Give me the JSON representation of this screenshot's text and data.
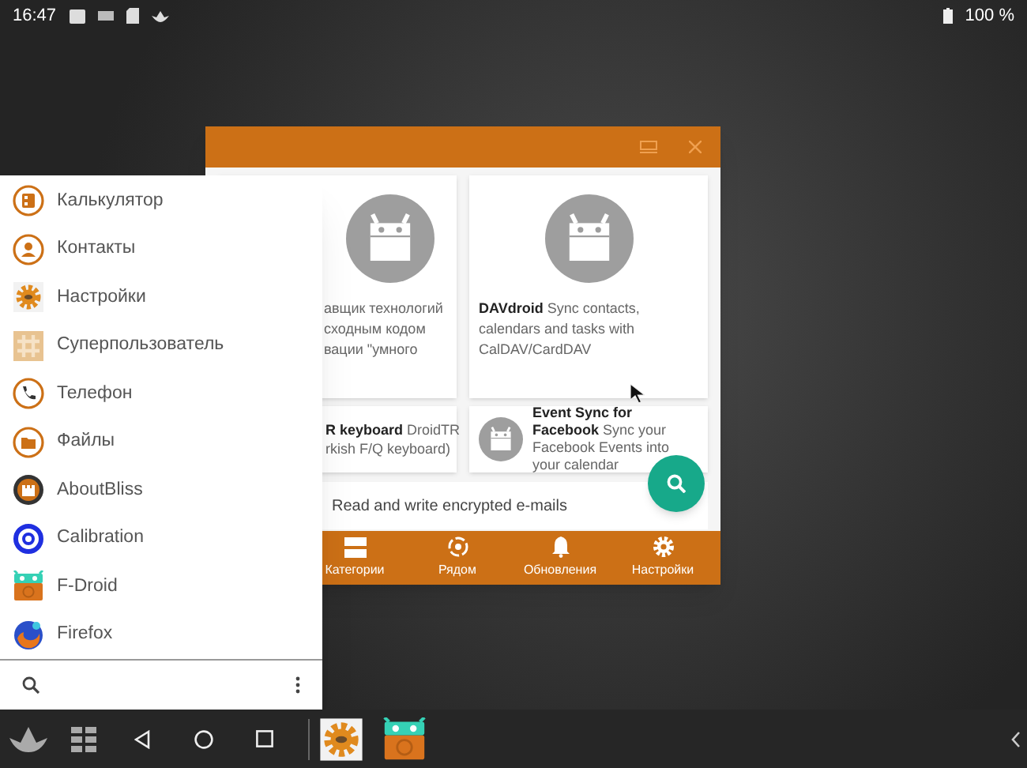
{
  "status_bar": {
    "time": "16:47",
    "battery": "100 %"
  },
  "window": {
    "cards": [
      {
        "kind": "large",
        "lines": [
          "авщик технологий",
          "сходным кодом",
          "вации \"умного"
        ]
      },
      {
        "kind": "large",
        "lines": [
          "**DAVdroid** Sync contacts, calendars and tasks with CalDAV/CardDAV"
        ]
      },
      {
        "kind": "small",
        "lines": [
          "**R keyboard** DroidTR",
          "rkish F/Q keyboard)"
        ]
      },
      {
        "kind": "small-icon",
        "lines": [
          "**Event Sync for Facebook** Sync your Facebook Events into your calendar"
        ]
      }
    ],
    "list_text": "Read and write encrypted e-mails",
    "nav": [
      {
        "kind": "categories",
        "label": "Категории"
      },
      {
        "kind": "nearby",
        "label": "Рядом"
      },
      {
        "kind": "updates",
        "label": "Обновления"
      },
      {
        "kind": "settings",
        "label": "Настройки"
      }
    ]
  },
  "start_menu": {
    "items": [
      {
        "kind": "calculator",
        "label": "Калькулятор"
      },
      {
        "kind": "contacts",
        "label": "Контакты"
      },
      {
        "kind": "settings",
        "label": "Настройки"
      },
      {
        "kind": "superuser",
        "label": "Суперпользователь"
      },
      {
        "kind": "phone",
        "label": "Телефон"
      },
      {
        "kind": "files",
        "label": "Файлы"
      },
      {
        "kind": "aboutbliss",
        "label": "AboutBliss"
      },
      {
        "kind": "calibration",
        "label": "Calibration"
      },
      {
        "kind": "fdroid",
        "label": "F-Droid"
      },
      {
        "kind": "firefox",
        "label": "Firefox"
      }
    ]
  },
  "taskbar": {
    "apps": [
      {
        "kind": "settings"
      },
      {
        "kind": "fdroid"
      }
    ]
  }
}
